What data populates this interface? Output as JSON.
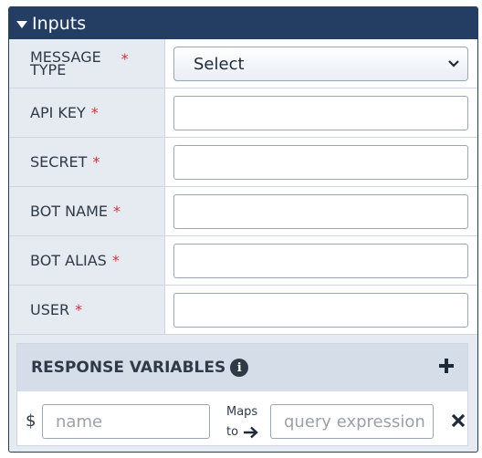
{
  "panel": {
    "title": "Inputs"
  },
  "fields": [
    {
      "label_line1": "MESSAGE",
      "label_line2": "TYPE",
      "required": "*",
      "type": "select",
      "value": "Select"
    },
    {
      "label": "API KEY",
      "required": "*",
      "type": "text",
      "value": ""
    },
    {
      "label": "SECRET",
      "required": "*",
      "type": "text",
      "value": ""
    },
    {
      "label": "BOT NAME",
      "required": "*",
      "type": "text",
      "value": ""
    },
    {
      "label": "BOT ALIAS",
      "required": "*",
      "type": "text",
      "value": ""
    },
    {
      "label": "USER",
      "required": "*",
      "type": "text",
      "value": ""
    }
  ],
  "response": {
    "title": "RESPONSE VARIABLES",
    "info_icon": "info-circle-icon",
    "add_icon": "plus-icon",
    "row": {
      "prefix": "$",
      "name_placeholder": "name",
      "maps_line1": "Maps",
      "maps_line2": "to",
      "query_placeholder": "query expression",
      "remove_icon": "close-icon"
    }
  },
  "colors": {
    "header": "#243e63",
    "required": "#d6313a",
    "label_bg": "#e6ebf2",
    "section_bg": "#d5dde8"
  }
}
